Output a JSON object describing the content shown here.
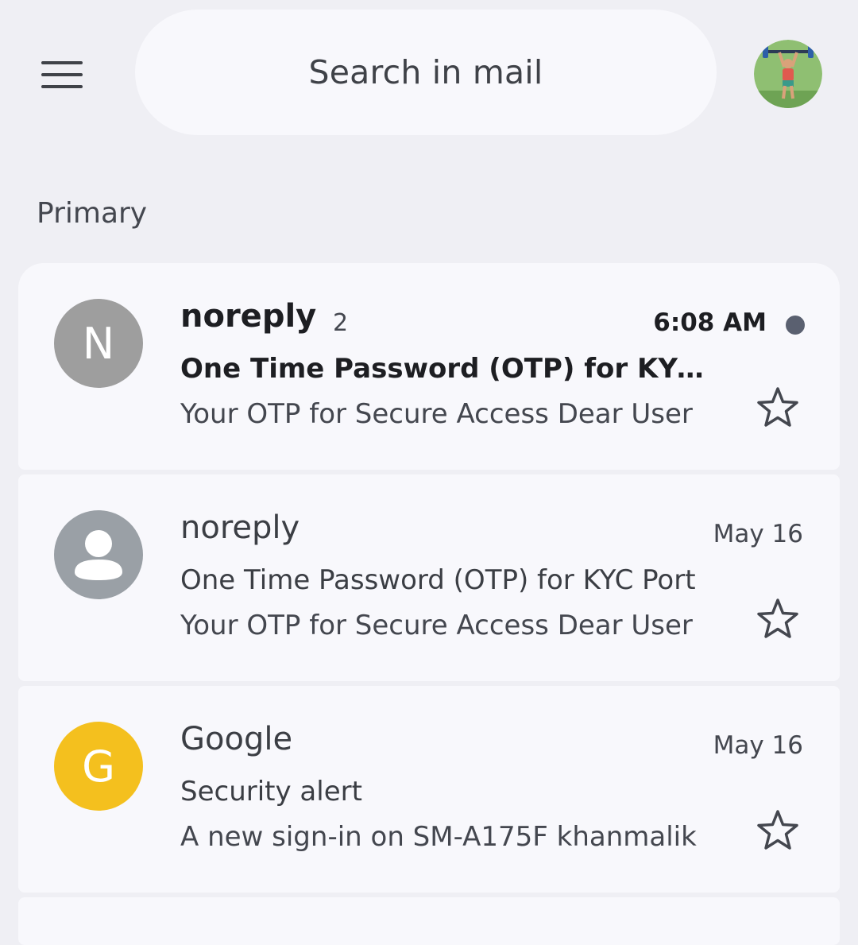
{
  "search": {
    "label": "Search in mail"
  },
  "section": {
    "label": "Primary"
  },
  "colors": {
    "background": "#efeff4",
    "card": "#f8f8fc",
    "avatar_n": "#9e9e9e",
    "avatar_person": "#9aa0a6",
    "avatar_g": "#f4c01e",
    "unread_dot": "#5a6070"
  },
  "emails": [
    {
      "avatar_letter": "N",
      "sender": "noreply",
      "count": "2",
      "time": "6:08 AM",
      "subject": "One Time Password (OTP) for KYC Port",
      "snippet": "Your OTP for Secure Access Dear User",
      "unread": true,
      "starred": false
    },
    {
      "avatar_icon": "person-icon",
      "sender": "noreply",
      "time": "May 16",
      "subject": "One Time Password (OTP) for KYC Port",
      "snippet": "Your OTP for Secure Access Dear User",
      "unread": false,
      "starred": false
    },
    {
      "avatar_letter": "G",
      "sender": "Google",
      "time": "May 16",
      "subject": "Security alert",
      "snippet": "A new sign-in on SM-A175F khanmalik",
      "unread": false,
      "starred": false
    }
  ],
  "icons": {
    "menu": "hamburger-menu-icon",
    "account": "account-avatar-icon",
    "star": "star-outline-icon",
    "unread": "unread-dot-icon"
  }
}
